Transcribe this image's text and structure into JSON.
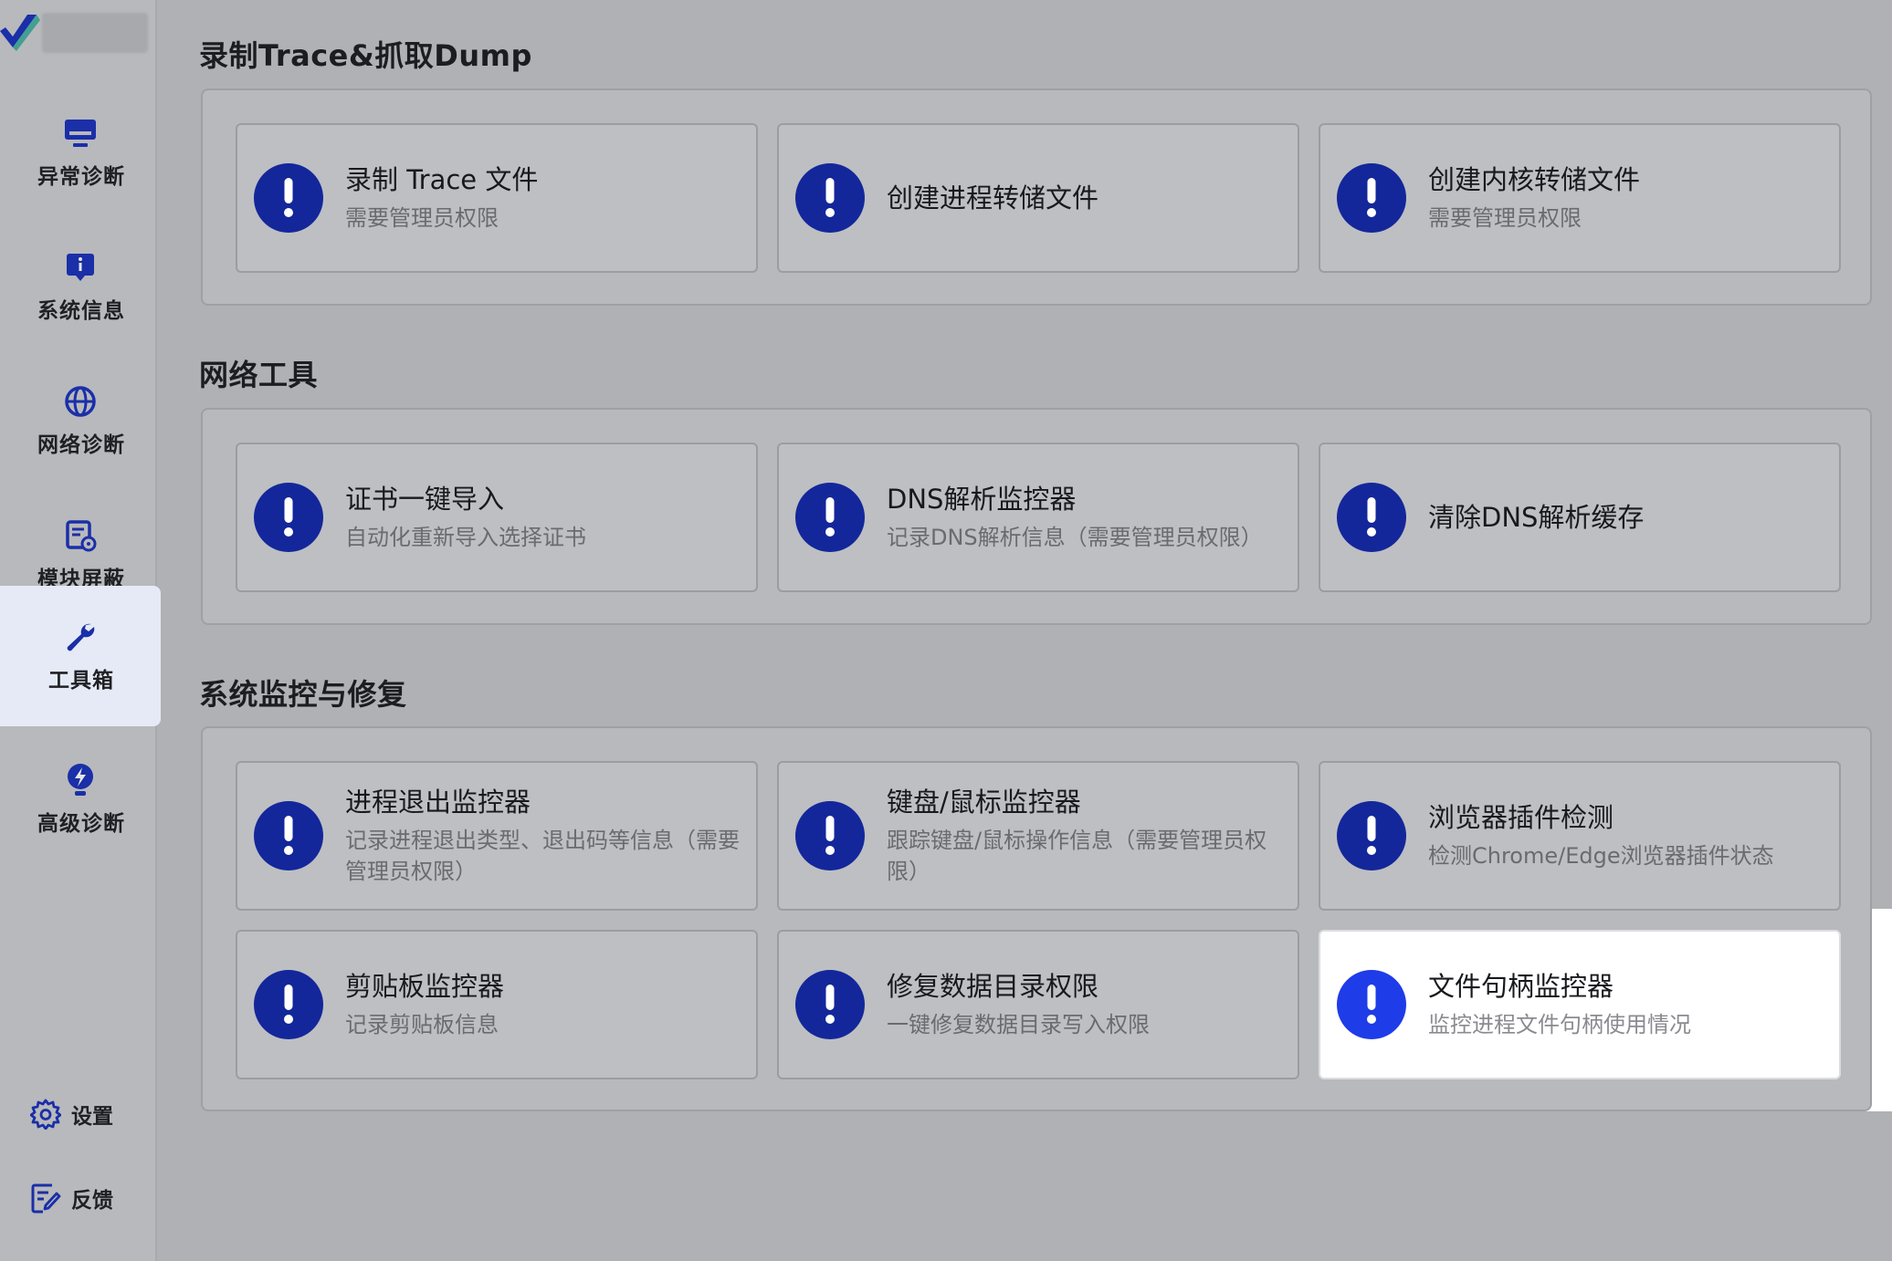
{
  "sidebar": {
    "items": [
      {
        "label": "异常诊断",
        "icon": "monitor-icon"
      },
      {
        "label": "系统信息",
        "icon": "info-chat-icon"
      },
      {
        "label": "网络诊断",
        "icon": "globe-icon"
      },
      {
        "label": "模块屏蔽",
        "icon": "module-settings-icon"
      },
      {
        "label": "工具箱",
        "icon": "wrench-icon"
      },
      {
        "label": "高级诊断",
        "icon": "lightning-bulb-icon"
      }
    ],
    "active_index": 4,
    "bottom": {
      "settings_label": "设置",
      "feedback_label": "反馈"
    }
  },
  "sections": [
    {
      "title": "录制Trace&抓取Dump",
      "cards": [
        {
          "title": "录制 Trace 文件",
          "subtitle": "需要管理员权限"
        },
        {
          "title": "创建进程转储文件",
          "subtitle": ""
        },
        {
          "title": "创建内核转储文件",
          "subtitle": "需要管理员权限"
        }
      ]
    },
    {
      "title": "网络工具",
      "cards": [
        {
          "title": "证书一键导入",
          "subtitle": "自动化重新导入选择证书"
        },
        {
          "title": "DNS解析监控器",
          "subtitle": "记录DNS解析信息（需要管理员权限）"
        },
        {
          "title": "清除DNS解析缓存",
          "subtitle": ""
        }
      ]
    },
    {
      "title": "系统监控与修复",
      "cards": [
        {
          "title": "进程退出监控器",
          "subtitle": "记录进程退出类型、退出码等信息（需要管理员权限）"
        },
        {
          "title": "键盘/鼠标监控器",
          "subtitle": "跟踪键盘/鼠标操作信息（需要管理员权限）"
        },
        {
          "title": "浏览器插件检测",
          "subtitle": "检测Chrome/Edge浏览器插件状态"
        },
        {
          "title": "剪贴板监控器",
          "subtitle": "记录剪贴板信息"
        },
        {
          "title": "修复数据目录权限",
          "subtitle": "一键修复数据目录写入权限"
        },
        {
          "title": "文件句柄监控器",
          "subtitle": "监控进程文件句柄使用情况"
        }
      ]
    }
  ],
  "colors": {
    "icon_blue": "#13279b",
    "icon_blue_highlight": "#1e3ce8",
    "active_nav_bg": "#e6eaf6",
    "nav_icon_blue": "#1a2fa8"
  }
}
